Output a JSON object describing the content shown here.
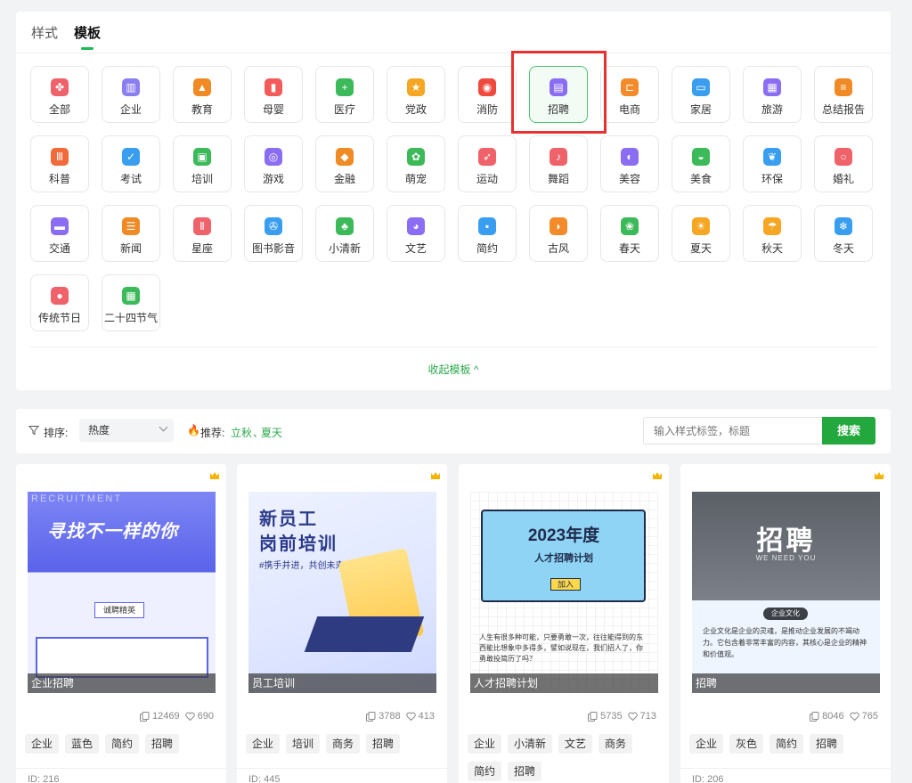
{
  "tabs": [
    {
      "label": "样式"
    },
    {
      "label": "模板"
    }
  ],
  "categories": [
    {
      "label": "全部",
      "icon": "pinwheel-icon",
      "color": "#f0626a"
    },
    {
      "label": "企业",
      "icon": "building-icon",
      "color": "#8b7ef0"
    },
    {
      "label": "教育",
      "icon": "graduation-cap-icon",
      "color": "#f08a24"
    },
    {
      "label": "母婴",
      "icon": "baby-bottle-icon",
      "color": "#f35b5b"
    },
    {
      "label": "医疗",
      "icon": "medical-kit-icon",
      "color": "#3cba5a"
    },
    {
      "label": "党政",
      "icon": "star-icon",
      "color": "#f5a623"
    },
    {
      "label": "消防",
      "icon": "alarm-icon",
      "color": "#ef4a3d"
    },
    {
      "label": "招聘",
      "icon": "recruit-icon",
      "color": "#8a6df2"
    },
    {
      "label": "电商",
      "icon": "cart-icon",
      "color": "#f38b2a"
    },
    {
      "label": "家居",
      "icon": "sofa-icon",
      "color": "#3a9ef0"
    },
    {
      "label": "旅游",
      "icon": "luggage-icon",
      "color": "#8a6df2"
    },
    {
      "label": "总结报告",
      "icon": "report-icon",
      "color": "#f08a24"
    },
    {
      "label": "科普",
      "icon": "books-icon",
      "color": "#f26a3a"
    },
    {
      "label": "考试",
      "icon": "score-icon",
      "color": "#3a9ef0"
    },
    {
      "label": "培训",
      "icon": "training-board-icon",
      "color": "#3cba5a"
    },
    {
      "label": "游戏",
      "icon": "gamepad-icon",
      "color": "#8a6df2"
    },
    {
      "label": "金融",
      "icon": "coin-icon",
      "color": "#f08a24"
    },
    {
      "label": "萌宠",
      "icon": "paw-icon",
      "color": "#3cba5a"
    },
    {
      "label": "运动",
      "icon": "runner-icon",
      "color": "#f0626a"
    },
    {
      "label": "舞蹈",
      "icon": "dance-shoes-icon",
      "color": "#f0626a"
    },
    {
      "label": "美容",
      "icon": "beauty-icon",
      "color": "#8a6df2"
    },
    {
      "label": "美食",
      "icon": "dish-icon",
      "color": "#3cba5a"
    },
    {
      "label": "环保",
      "icon": "leaf-icon",
      "color": "#3a9ef0"
    },
    {
      "label": "婚礼",
      "icon": "ring-icon",
      "color": "#f0626a"
    },
    {
      "label": "交通",
      "icon": "bus-icon",
      "color": "#8a6df2"
    },
    {
      "label": "新闻",
      "icon": "newspaper-icon",
      "color": "#f08a24"
    },
    {
      "label": "星座",
      "icon": "gemini-icon",
      "color": "#f0626a"
    },
    {
      "label": "图书影音",
      "icon": "film-reel-icon",
      "color": "#3a9ef0"
    },
    {
      "label": "小清新",
      "icon": "plant-icon",
      "color": "#3cba5a"
    },
    {
      "label": "文艺",
      "icon": "palette-icon",
      "color": "#8a6df2"
    },
    {
      "label": "简约",
      "icon": "simple-shapes-icon",
      "color": "#3a9ef0"
    },
    {
      "label": "古风",
      "icon": "fan-icon",
      "color": "#f38b2a"
    },
    {
      "label": "春天",
      "icon": "sprout-icon",
      "color": "#3cba5a"
    },
    {
      "label": "夏天",
      "icon": "sun-icon",
      "color": "#f5a623"
    },
    {
      "label": "秋天",
      "icon": "umbrella-icon",
      "color": "#f5a623"
    },
    {
      "label": "冬天",
      "icon": "snowflake-icon",
      "color": "#3a9ef0"
    },
    {
      "label": "传统节日",
      "icon": "balloon-icon",
      "color": "#f0626a"
    },
    {
      "label": "二十四节气",
      "icon": "calendar-icon",
      "color": "#3cba5a"
    }
  ],
  "active_category": "招聘",
  "collapse_label": "收起模板 ^",
  "filter": {
    "sort_label": "排序:",
    "sort_value": "热度",
    "recommend_label": "推荐:",
    "recommend_links": [
      "立秋",
      "夏天"
    ],
    "search_placeholder": "输入样式标签，标题",
    "search_button": "搜索"
  },
  "cards": [
    {
      "label": "企业招聘",
      "copies": "12469",
      "likes": "690",
      "tags": [
        "企业",
        "蓝色",
        "简约",
        "招聘"
      ],
      "id": "ID: 216",
      "thumb_title": "寻找不一样的你",
      "thumb_sub": "RECRUITMENT",
      "thumb_badge": "诚聘精英"
    },
    {
      "label": "员工培训",
      "copies": "3788",
      "likes": "413",
      "tags": [
        "企业",
        "培训",
        "商务",
        "招聘"
      ],
      "id": "ID: 445",
      "thumb_title1": "新员工",
      "thumb_title2": "岗前培训",
      "thumb_sub": "#携手并进，共创未来#"
    },
    {
      "label": "人才招聘计划",
      "copies": "5735",
      "likes": "713",
      "tags": [
        "企业",
        "小清新",
        "文艺",
        "商务",
        "简约",
        "招聘"
      ],
      "id": "",
      "thumb_title1": "2023年度",
      "thumb_title2": "人才招聘计划",
      "thumb_btn": "加入",
      "thumb_text": "人生有很多种可能，只要勇敢一次，往往能得到的东西能比想象中多得多，譬如说现在，我们招人了，你勇敢投简历了吗？"
    },
    {
      "label": "招聘",
      "copies": "8046",
      "likes": "765",
      "tags": [
        "企业",
        "灰色",
        "简约",
        "招聘"
      ],
      "id": "ID: 206",
      "thumb_title": "招聘",
      "thumb_sub": "WE NEED YOU",
      "thumb_badge": "企业文化",
      "thumb_text": "企业文化是企业的灵魂，是推动企业发展的不竭动力。它包含着非常丰富的内容，其核心是企业的精神和价值观。"
    }
  ]
}
